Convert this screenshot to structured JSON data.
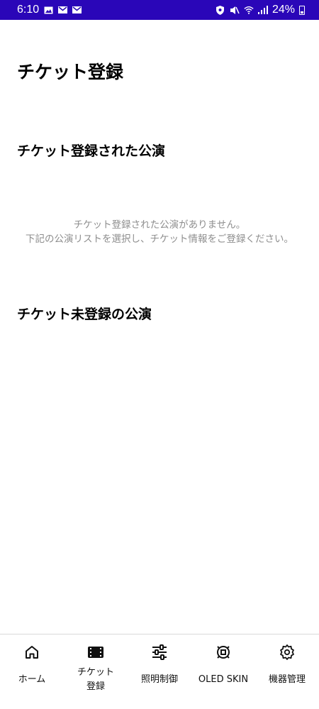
{
  "status_bar": {
    "time": "6:10",
    "battery": "24%",
    "left_icons": [
      "image-icon",
      "mail-icon",
      "mail-icon"
    ],
    "right_icons": [
      "shield-icon",
      "mute-icon",
      "wifi-icon",
      "signal-icon"
    ],
    "background_color": "#2a06b8"
  },
  "header": {
    "title": "チケット登録"
  },
  "registered": {
    "title": "チケット登録された公演",
    "empty_line1": "チケット登録された公演がありません。",
    "empty_line2": "下記の公演リストを選択し、チケット情報をご登録ください。"
  },
  "unregistered": {
    "title": "チケット未登録の公演"
  },
  "bottom_nav": {
    "items": [
      {
        "label": "ホーム",
        "icon": "home-icon"
      },
      {
        "label": "チケット\n登録",
        "icon": "ticket-icon",
        "active": true
      },
      {
        "label": "照明制御",
        "icon": "sliders-icon"
      },
      {
        "label": "OLED SKIN",
        "icon": "oled-skin-icon"
      },
      {
        "label": "機器管理",
        "icon": "gear-icon"
      }
    ]
  }
}
